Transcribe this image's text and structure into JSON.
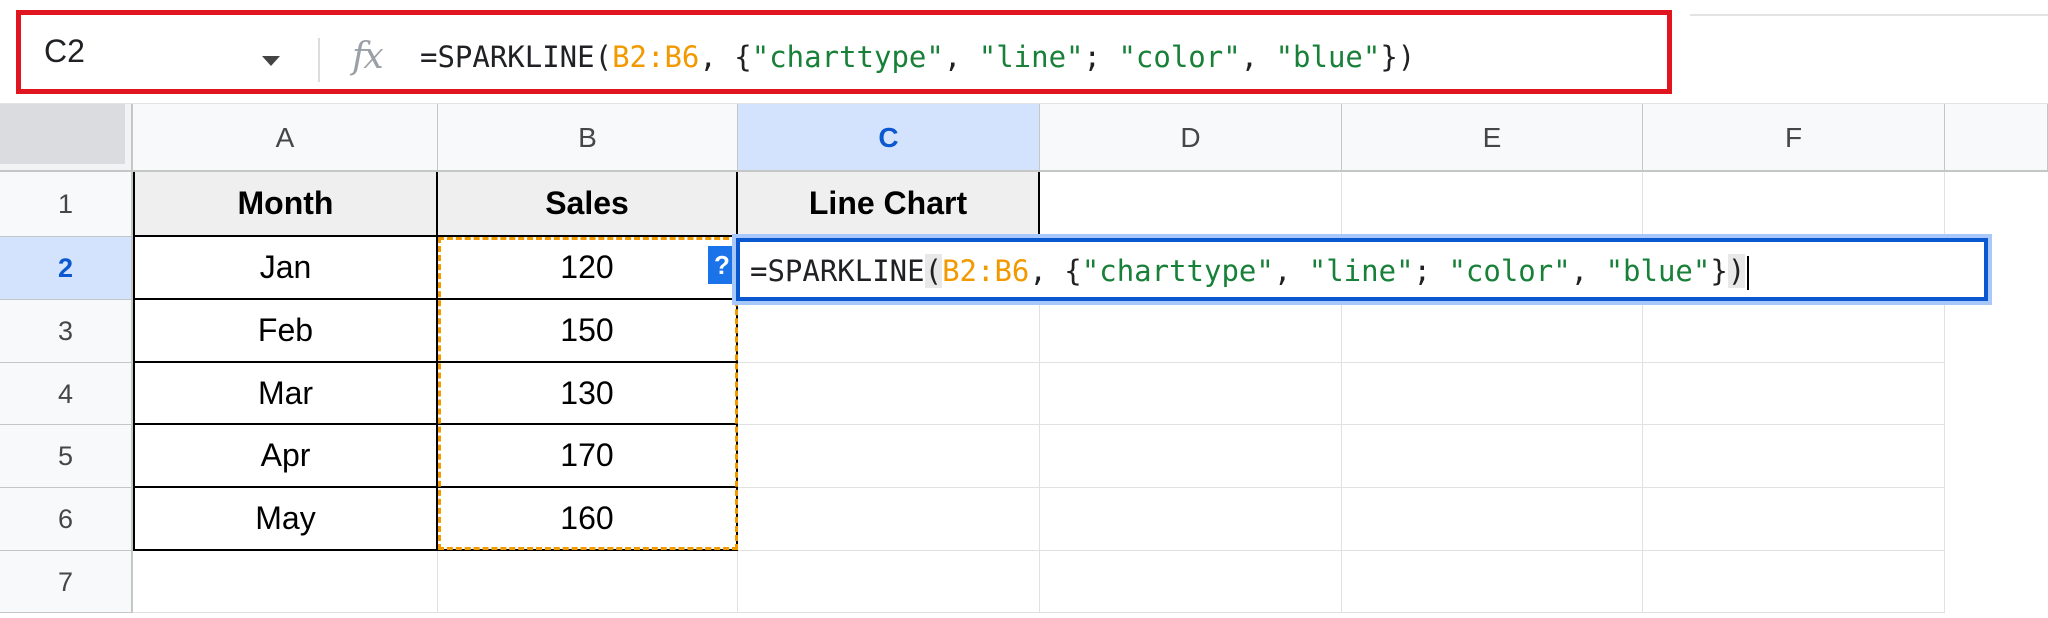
{
  "formula_bar": {
    "cell_ref": "C2",
    "fx_label": "fx",
    "formula": [
      {
        "text": "=SPARKLINE(",
        "color": "#202124"
      },
      {
        "text": "B2:B6",
        "color": "#f29900"
      },
      {
        "text": ", {",
        "color": "#202124"
      },
      {
        "text": "\"charttype\"",
        "color": "#188038"
      },
      {
        "text": ", ",
        "color": "#202124"
      },
      {
        "text": "\"line\"",
        "color": "#188038"
      },
      {
        "text": "; ",
        "color": "#202124"
      },
      {
        "text": "\"color\"",
        "color": "#188038"
      },
      {
        "text": ", ",
        "color": "#202124"
      },
      {
        "text": "\"blue\"",
        "color": "#188038"
      },
      {
        "text": "})",
        "color": "#202124"
      }
    ],
    "highlight_color": "#e0151f"
  },
  "columns": [
    "A",
    "B",
    "C",
    "D",
    "E",
    "F"
  ],
  "selected_column": "C",
  "rows": [
    "1",
    "2",
    "3",
    "4",
    "5",
    "6",
    "7"
  ],
  "selected_row": "2",
  "table": {
    "headers": [
      "Month",
      "Sales",
      "Line Chart"
    ],
    "data": [
      {
        "month": "Jan",
        "sales": "120"
      },
      {
        "month": "Feb",
        "sales": "150"
      },
      {
        "month": "Mar",
        "sales": "130"
      },
      {
        "month": "Apr",
        "sales": "170"
      },
      {
        "month": "May",
        "sales": "160"
      }
    ]
  },
  "cell_editor": {
    "help_badge": "?",
    "parts": [
      {
        "text": "=SPARKLINE",
        "color": "#202124"
      },
      {
        "text": "(",
        "color": "#202124"
      },
      {
        "text": "B2:B6",
        "color": "#f29900"
      },
      {
        "text": ", {",
        "color": "#202124"
      },
      {
        "text": "\"charttype\"",
        "color": "#188038"
      },
      {
        "text": ", ",
        "color": "#202124"
      },
      {
        "text": "\"line\"",
        "color": "#188038"
      },
      {
        "text": "; ",
        "color": "#202124"
      },
      {
        "text": "\"color\"",
        "color": "#188038"
      },
      {
        "text": ", ",
        "color": "#202124"
      },
      {
        "text": "\"blue\"",
        "color": "#188038"
      },
      {
        "text": "}",
        "color": "#202124"
      },
      {
        "text": ")",
        "color": "#202124"
      }
    ],
    "border_color": "#0b57d0"
  },
  "colors": {
    "range_highlight": "#f29900",
    "selection_header_bg": "#d3e3fd",
    "selection_header_text": "#0b57d0"
  }
}
